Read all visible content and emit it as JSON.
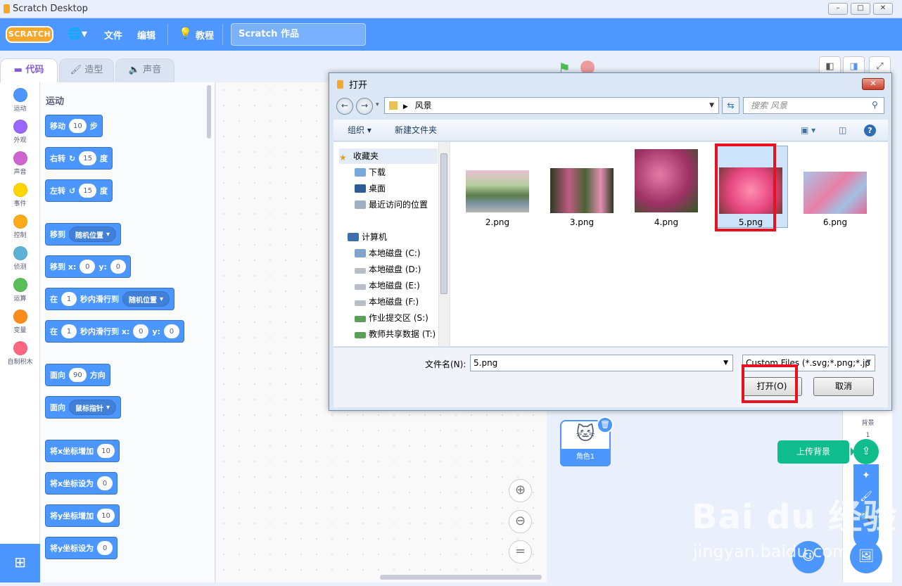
{
  "app": {
    "title": "Scratch Desktop"
  },
  "menu": {
    "logo": "SCRATCH",
    "file": "文件",
    "edit": "编辑",
    "tutorial": "教程",
    "project_name": "Scratch 作品"
  },
  "tabs": [
    {
      "label": "代码"
    },
    {
      "label": "造型"
    },
    {
      "label": "声音"
    }
  ],
  "categories": [
    {
      "label": "运动",
      "color": "#4c97ff"
    },
    {
      "label": "外观",
      "color": "#9966ff"
    },
    {
      "label": "声音",
      "color": "#cf63cf"
    },
    {
      "label": "事件",
      "color": "#ffd500"
    },
    {
      "label": "控制",
      "color": "#ffab19"
    },
    {
      "label": "侦测",
      "color": "#5cb1d6"
    },
    {
      "label": "运算",
      "color": "#59c059"
    },
    {
      "label": "变量",
      "color": "#ff8c1a"
    },
    {
      "label": "自制积木",
      "color": "#ff6680"
    }
  ],
  "palette": {
    "heading": "运动",
    "move": {
      "a": "移动",
      "v": "10",
      "b": "步"
    },
    "turn_right": {
      "a": "右转",
      "v": "15",
      "b": "度"
    },
    "turn_left": {
      "a": "左转",
      "v": "15",
      "b": "度"
    },
    "goto": {
      "a": "移到",
      "dd": "随机位置"
    },
    "goto_xy": {
      "a": "移到 x:",
      "x": "0",
      "y_label": "y:",
      "y": "0"
    },
    "glide": {
      "a": "在",
      "v": "1",
      "b": "秒内滑行到",
      "dd": "随机位置"
    },
    "glide_xy": {
      "a": "在",
      "v": "1",
      "b": "秒内滑行到 x:",
      "x": "0",
      "y_label": "y:",
      "y": "0"
    },
    "point_dir": {
      "a": "面向",
      "v": "90",
      "b": "方向"
    },
    "point_to": {
      "a": "面向",
      "dd": "鼠标指针"
    },
    "change_x": {
      "a": "将x坐标增加",
      "v": "10"
    },
    "set_x": {
      "a": "将x坐标设为",
      "v": "0"
    },
    "change_y": {
      "a": "将y坐标增加",
      "v": "10"
    },
    "set_y": {
      "a": "将y坐标设为",
      "v": "0"
    }
  },
  "sprite": {
    "name": "角色1"
  },
  "stage": {
    "label": "背景",
    "count": "1",
    "upload_tooltip": "上传背景"
  },
  "dialog": {
    "title": "打开",
    "path": "风景",
    "search_placeholder": "搜索 风景",
    "organize": "组织",
    "new_folder": "新建文件夹",
    "tree": [
      {
        "label": "收藏夹"
      },
      {
        "label": "下载"
      },
      {
        "label": "桌面"
      },
      {
        "label": "最近访问的位置"
      },
      {
        "label": "计算机"
      },
      {
        "label": "本地磁盘 (C:)"
      },
      {
        "label": "本地磁盘 (D:)"
      },
      {
        "label": "本地磁盘 (E:)"
      },
      {
        "label": "本地磁盘 (F:)"
      },
      {
        "label": "作业提交区 (S:)"
      },
      {
        "label": "教师共享数据 (T:)"
      }
    ],
    "files": [
      {
        "name": "2.png"
      },
      {
        "name": "3.png"
      },
      {
        "name": "4.png"
      },
      {
        "name": "5.png"
      },
      {
        "name": "6.png"
      }
    ],
    "filename_label": "文件名(N):",
    "filename_value": "5.png",
    "filetype": "Custom Files (*.svg;*.png;*.jp",
    "open_button": "打开(O)",
    "cancel_button": "取消"
  },
  "watermark": {
    "brand": "Bai du 经验",
    "url": "jingyan.baidu.com"
  }
}
